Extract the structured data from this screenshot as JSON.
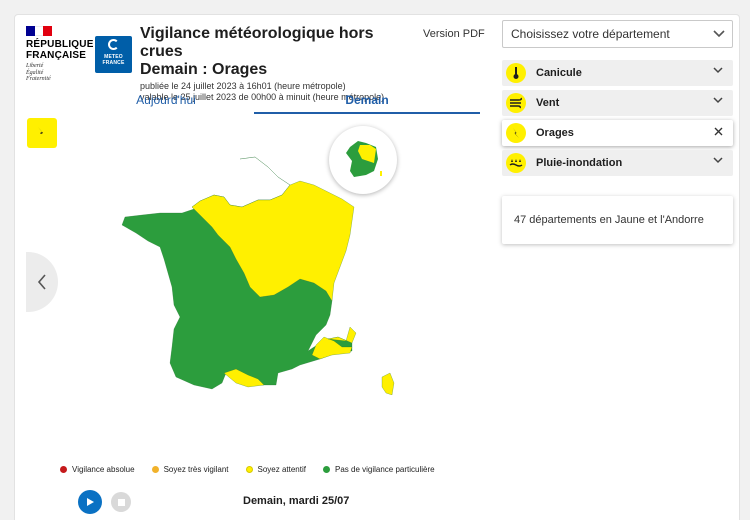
{
  "header": {
    "republic_name_line1": "RÉPUBLIQUE",
    "republic_name_line2": "FRANÇAISE",
    "motto_1": "Liberté",
    "motto_2": "Égalité",
    "motto_3": "Fraternité",
    "meteo_logo_line1": "METEO",
    "meteo_logo_line2": "FRANCE",
    "title": "Vigilance météorologique hors crues",
    "subtitle": "Demain : Orages",
    "published": "publiée le 24 juillet 2023 à 16h01 (heure métropole)",
    "valid": "valable le 25 juillet 2023 de 00h00 à minuit (heure métropole)",
    "pdf_label": "Version PDF"
  },
  "tabs": [
    {
      "label": "Aujourd'hui",
      "active": false
    },
    {
      "label": "Demain",
      "active": true
    }
  ],
  "department_select": {
    "value": "Choisissez votre département"
  },
  "phenomena": [
    {
      "label": "Canicule",
      "icon": "thermometer-icon",
      "active": false
    },
    {
      "label": "Vent",
      "icon": "wind-icon",
      "active": false
    },
    {
      "label": "Orages",
      "icon": "lightning-icon",
      "active": true
    },
    {
      "label": "Pluie-inondation",
      "icon": "rain-flood-icon",
      "active": false
    }
  ],
  "info_text": "47 départements en Jaune et l'Andorre",
  "legend": [
    {
      "label": "Vigilance absolue",
      "color": "#c51a1c"
    },
    {
      "label": "Soyez très vigilant",
      "color": "#f1b22b"
    },
    {
      "label": "Soyez attentif",
      "color": "#fff000"
    },
    {
      "label": "Pas de vigilance particulière",
      "color": "#2c9d3d"
    }
  ],
  "player": {
    "date_label": "Demain, mardi 25/07"
  },
  "colors": {
    "green": "#2c9d3d",
    "yellow": "#fff000",
    "blue_accent": "#205ea8",
    "flag_blue": "#000091",
    "flag_red": "#e1000f"
  }
}
